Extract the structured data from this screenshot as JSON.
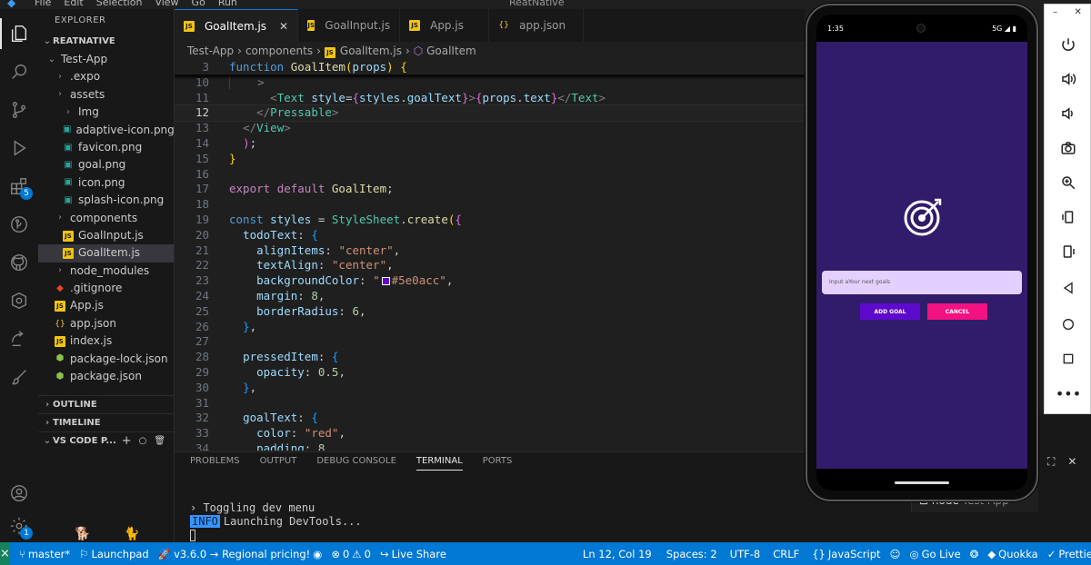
{
  "titlebar": {
    "menu": [
      "File",
      "Edit",
      "Selection",
      "View",
      "Go",
      "Run"
    ],
    "title": "ReatNative"
  },
  "explorer": {
    "title": "EXPLORER",
    "workspace": "REATNATIVE",
    "tree": [
      {
        "label": "Test-App",
        "icon": "chevron-down",
        "indent": 1
      },
      {
        "label": ".expo",
        "icon": "folder-icon",
        "indent": 2
      },
      {
        "label": "assets",
        "icon": "folder-icon",
        "indent": 2
      },
      {
        "label": "Img",
        "icon": "folder-icon",
        "indent": 3
      },
      {
        "label": "adaptive-icon.png",
        "icon": "image-icon",
        "indent": 3
      },
      {
        "label": "favicon.png",
        "icon": "image-icon",
        "indent": 3
      },
      {
        "label": "goal.png",
        "icon": "image-icon",
        "indent": 3
      },
      {
        "label": "icon.png",
        "icon": "image-icon",
        "indent": 3
      },
      {
        "label": "splash-icon.png",
        "icon": "image-icon",
        "indent": 3
      },
      {
        "label": "components",
        "icon": "folder-icon",
        "indent": 2
      },
      {
        "label": "GoalInput.js",
        "icon": "js-icon",
        "indent": 3
      },
      {
        "label": "GoalItem.js",
        "icon": "js-icon",
        "indent": 3,
        "selected": true
      },
      {
        "label": "node_modules",
        "icon": "folder-icon",
        "indent": 2
      },
      {
        "label": ".gitignore",
        "icon": "git-icon",
        "indent": 2
      },
      {
        "label": "App.js",
        "icon": "js-icon",
        "indent": 2
      },
      {
        "label": "app.json",
        "icon": "json-icon",
        "indent": 2
      },
      {
        "label": "index.js",
        "icon": "js-icon",
        "indent": 2
      },
      {
        "label": "package-lock.json",
        "icon": "npm-icon",
        "indent": 2
      },
      {
        "label": "package.json",
        "icon": "npm-icon",
        "indent": 2
      }
    ],
    "outline": "OUTLINE",
    "timeline": "TIMELINE",
    "vscode_pets": "VS CODE P..."
  },
  "tabs": [
    {
      "label": "GoalItem.js",
      "icon": "js-icon",
      "active": true
    },
    {
      "label": "GoalInput.js",
      "icon": "js-icon"
    },
    {
      "label": "App.js",
      "icon": "js-icon"
    },
    {
      "label": "app.json",
      "icon": "json-icon"
    }
  ],
  "breadcrumb": [
    "Test-App",
    "components",
    "GoalItem.js",
    "GoalItem"
  ],
  "editor": {
    "sticky_line": "3",
    "sticky_code": "function GoalItem(props) {",
    "current_line": "12",
    "line_numbers": [
      "10",
      "11",
      "12",
      "13",
      "14",
      "15",
      "16",
      "17",
      "18",
      "19",
      "20",
      "21",
      "22",
      "23",
      "24",
      "25",
      "26",
      "27",
      "28",
      "29",
      "30",
      "31",
      "32",
      "33",
      "34"
    ],
    "swatch_color": "#5e0acc"
  },
  "panel": {
    "tabs": [
      "PROBLEMS",
      "OUTPUT",
      "DEBUG CONSOLE",
      "TERMINAL",
      "PORTS"
    ],
    "active_tab": "TERMINAL",
    "terminal_line1": "› Toggling dev menu",
    "terminal_info": "INFO",
    "terminal_line2": "Launching DevTools...",
    "terminal_name": "node",
    "terminal_folder": "Test-App"
  },
  "statusbar": {
    "branch": "master*",
    "launchpad": "Launchpad",
    "version": "v3.6.0 → Regional pricing!",
    "problems": "0",
    "warnings": "0",
    "live_share": "Live Share",
    "position": "Ln 12, Col 19",
    "spaces": "Spaces: 2",
    "encoding": "UTF-8",
    "eol": "CRLF",
    "language": "JavaScript",
    "go_live": "Go Live",
    "quokka": "Quokka",
    "prettier": "Prettier"
  },
  "phone": {
    "time": "1:35",
    "network": "5G",
    "input_placeholder": "Input aYour next goals",
    "add_label": "ADD GOAL",
    "cancel_label": "CANCEL",
    "bg_color": "#311b6b",
    "add_color": "#5e0acc",
    "cancel_color": "#f31282"
  },
  "colors": {
    "statusbar": "#0078d4",
    "accent": "#0078d4"
  }
}
